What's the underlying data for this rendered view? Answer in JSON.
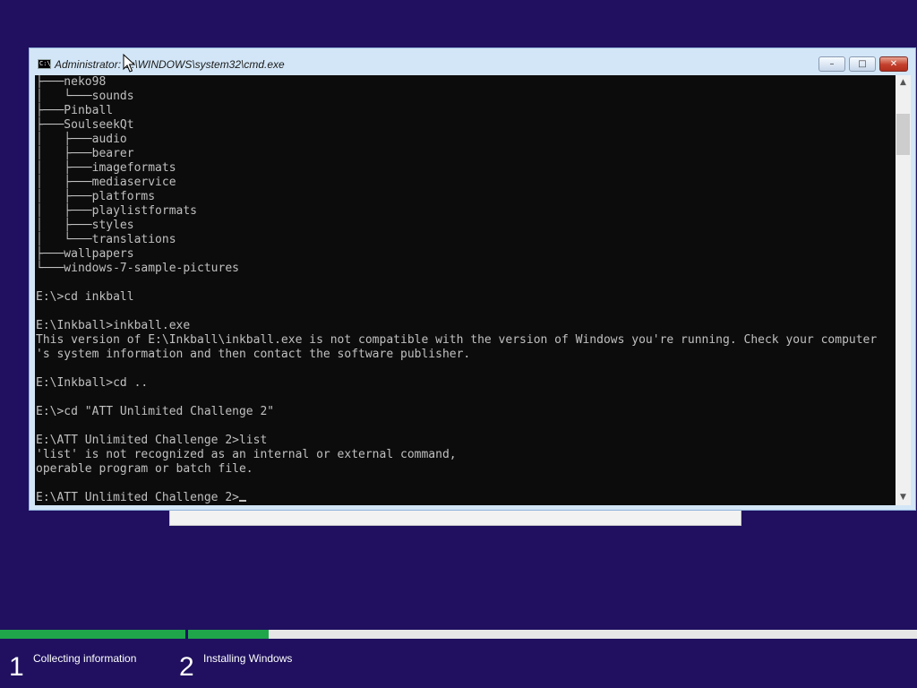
{
  "console_window": {
    "title": "Administrator: C:\\WINDOWS\\system32\\cmd.exe",
    "icon": "cmd-icon",
    "minimize_symbol": "–",
    "maximize_symbol": "□",
    "close_symbol": "✕",
    "lines": [
      "├───neko98",
      "│   └───sounds",
      "├───Pinball",
      "├───SoulseekQt",
      "│   ├───audio",
      "│   ├───bearer",
      "│   ├───imageformats",
      "│   ├───mediaservice",
      "│   ├───platforms",
      "│   ├───playlistformats",
      "│   ├───styles",
      "│   └───translations",
      "├───wallpapers",
      "└───windows-7-sample-pictures",
      "",
      "E:\\>cd inkball",
      "",
      "E:\\Inkball>inkball.exe",
      "This version of E:\\Inkball\\inkball.exe is not compatible with the version of Windows you're running. Check your computer",
      "'s system information and then contact the software publisher.",
      "",
      "E:\\Inkball>cd ..",
      "",
      "E:\\>cd \"ATT Unlimited Challenge 2\"",
      "",
      "E:\\ATT Unlimited Challenge 2>list",
      "'list' is not recognized as an internal or external command,",
      "operable program or batch file.",
      ""
    ],
    "prompt": "E:\\ATT Unlimited Challenge 2>",
    "text_color": "#c0c0c0",
    "background_color": "#0c0c0c",
    "scrollbar": {
      "up_arrow": "▲",
      "down_arrow": "▼"
    }
  },
  "setup": {
    "background_color": "#20105f",
    "accent_color": "#1fa64a",
    "progress": {
      "collecting_fraction": 1.0,
      "installing_fraction": 0.11
    },
    "steps": [
      {
        "number": "1",
        "label": "Collecting information"
      },
      {
        "number": "2",
        "label": "Installing Windows"
      }
    ]
  }
}
